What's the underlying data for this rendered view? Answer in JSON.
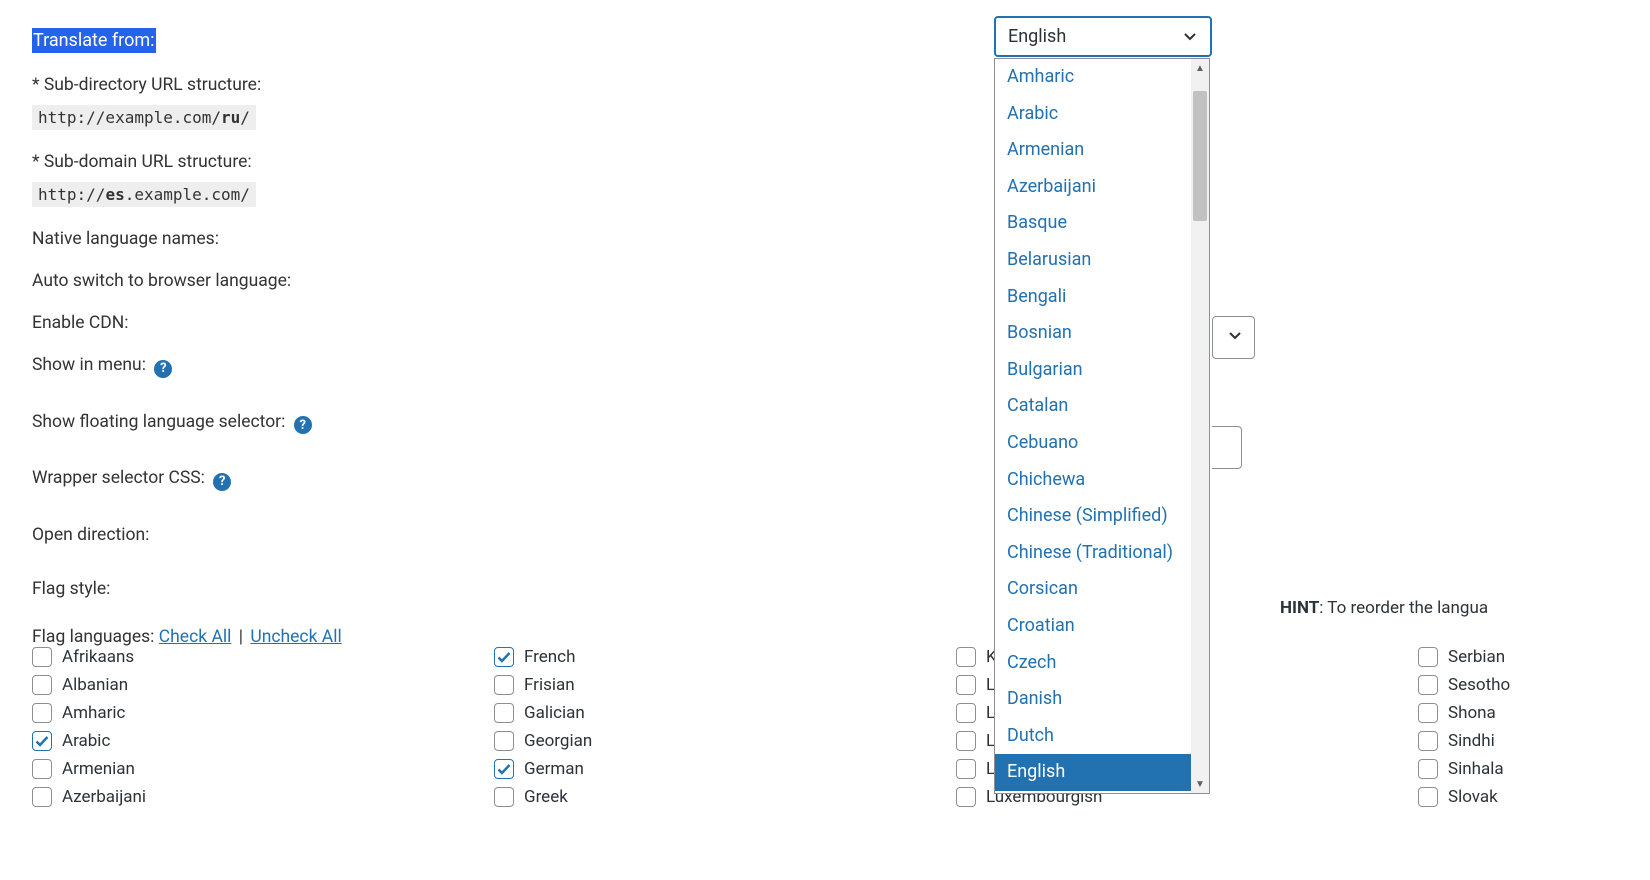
{
  "labels": {
    "translate_from": "Translate from:",
    "subdir_label": "* Sub-directory URL structure:",
    "subdir_code_pre": "http://example.com/",
    "subdir_code_bold": "ru",
    "subdir_code_post": "/",
    "subdom_label": "* Sub-domain URL structure:",
    "subdom_code_pre": "http://",
    "subdom_code_bold": "es",
    "subdom_code_post": ".example.com/",
    "native_names": "Native language names:",
    "auto_switch": "Auto switch to browser language:",
    "enable_cdn": "Enable CDN:",
    "show_in_menu": "Show in menu:",
    "show_floating": "Show floating language selector:",
    "wrapper_css": "Wrapper selector CSS:",
    "open_direction": "Open direction:",
    "flag_style": "Flag style:",
    "flag_languages": "Flag languages: ",
    "check_all": "Check All",
    "uncheck_all": "Uncheck All",
    "hint_bold": "HINT",
    "hint_rest": ": To reorder the langua"
  },
  "select": {
    "value": "English"
  },
  "dropdown_items": [
    "Amharic",
    "Arabic",
    "Armenian",
    "Azerbaijani",
    "Basque",
    "Belarusian",
    "Bengali",
    "Bosnian",
    "Bulgarian",
    "Catalan",
    "Cebuano",
    "Chichewa",
    "Chinese (Simplified)",
    "Chinese (Traditional)",
    "Corsican",
    "Croatian",
    "Czech",
    "Danish",
    "Dutch",
    "English"
  ],
  "dropdown_selected": "English",
  "col1": [
    {
      "label": "Afrikaans",
      "checked": false
    },
    {
      "label": "Albanian",
      "checked": false
    },
    {
      "label": "Amharic",
      "checked": false
    },
    {
      "label": "Arabic",
      "checked": true
    },
    {
      "label": "Armenian",
      "checked": false
    },
    {
      "label": "Azerbaijani",
      "checked": false
    }
  ],
  "col2": [
    {
      "label": "French",
      "checked": true
    },
    {
      "label": "Frisian",
      "checked": false
    },
    {
      "label": "Galician",
      "checked": false
    },
    {
      "label": "Georgian",
      "checked": false
    },
    {
      "label": "German",
      "checked": true
    },
    {
      "label": "Greek",
      "checked": false
    }
  ],
  "col3": [
    {
      "label": "Ky",
      "checked": false
    },
    {
      "label": "La",
      "checked": false
    },
    {
      "label": "La",
      "checked": false
    },
    {
      "label": "La",
      "checked": false
    },
    {
      "label": "Li",
      "checked": false
    },
    {
      "label": "Luxembourgish",
      "checked": false
    }
  ],
  "col4": [
    {
      "label": "Serbian",
      "checked": false
    },
    {
      "label": "Sesotho",
      "checked": false
    },
    {
      "label": "Shona",
      "checked": false
    },
    {
      "label": "Sindhi",
      "checked": false
    },
    {
      "label": "Sinhala",
      "checked": false
    },
    {
      "label": "Slovak",
      "checked": false
    }
  ]
}
